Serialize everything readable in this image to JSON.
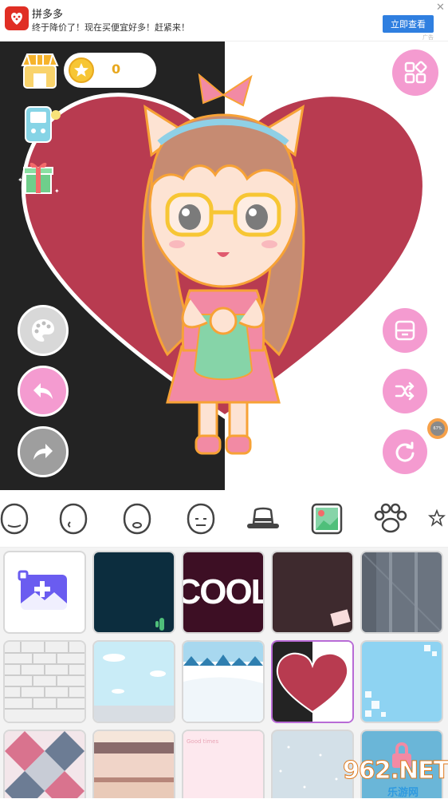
{
  "ad": {
    "title": "拼多多",
    "subtitle": "终于降价了！现在买便宜好多！赶紧来！",
    "button": "立即查看",
    "close": "✕",
    "tag": "广告",
    "brand_color": "#e02e24",
    "button_color": "#2f7fe0"
  },
  "top_left": {
    "shop_icon": "shop-icon",
    "coins": "0",
    "coin_icon": "star-coin-icon",
    "tamagotchi_icon": "game-console-icon",
    "gift_icon": "gift-icon"
  },
  "left_tools": [
    "palette-icon",
    "undo-icon",
    "redo-icon"
  ],
  "right_tools": [
    "grid-menu-icon",
    "save-icon",
    "shuffle-icon",
    "reset-icon"
  ],
  "progress_badge": "67%",
  "colors": {
    "accent_pink": "#f49bd0",
    "heart_red": "#b83b50",
    "selected_border": "#b86bd6",
    "dark_bg": "#232323"
  },
  "categories": [
    "face-shape-icon",
    "face-left-icon",
    "face-mouth-icon",
    "face-closed-icon",
    "hat-icon",
    "background-icon",
    "pet-paw-icon",
    "more-icon"
  ],
  "backgrounds": {
    "cool_text": "COOL",
    "good_times": "Good times"
  },
  "watermark": {
    "main": "962.NET",
    "sub": "乐游网"
  }
}
